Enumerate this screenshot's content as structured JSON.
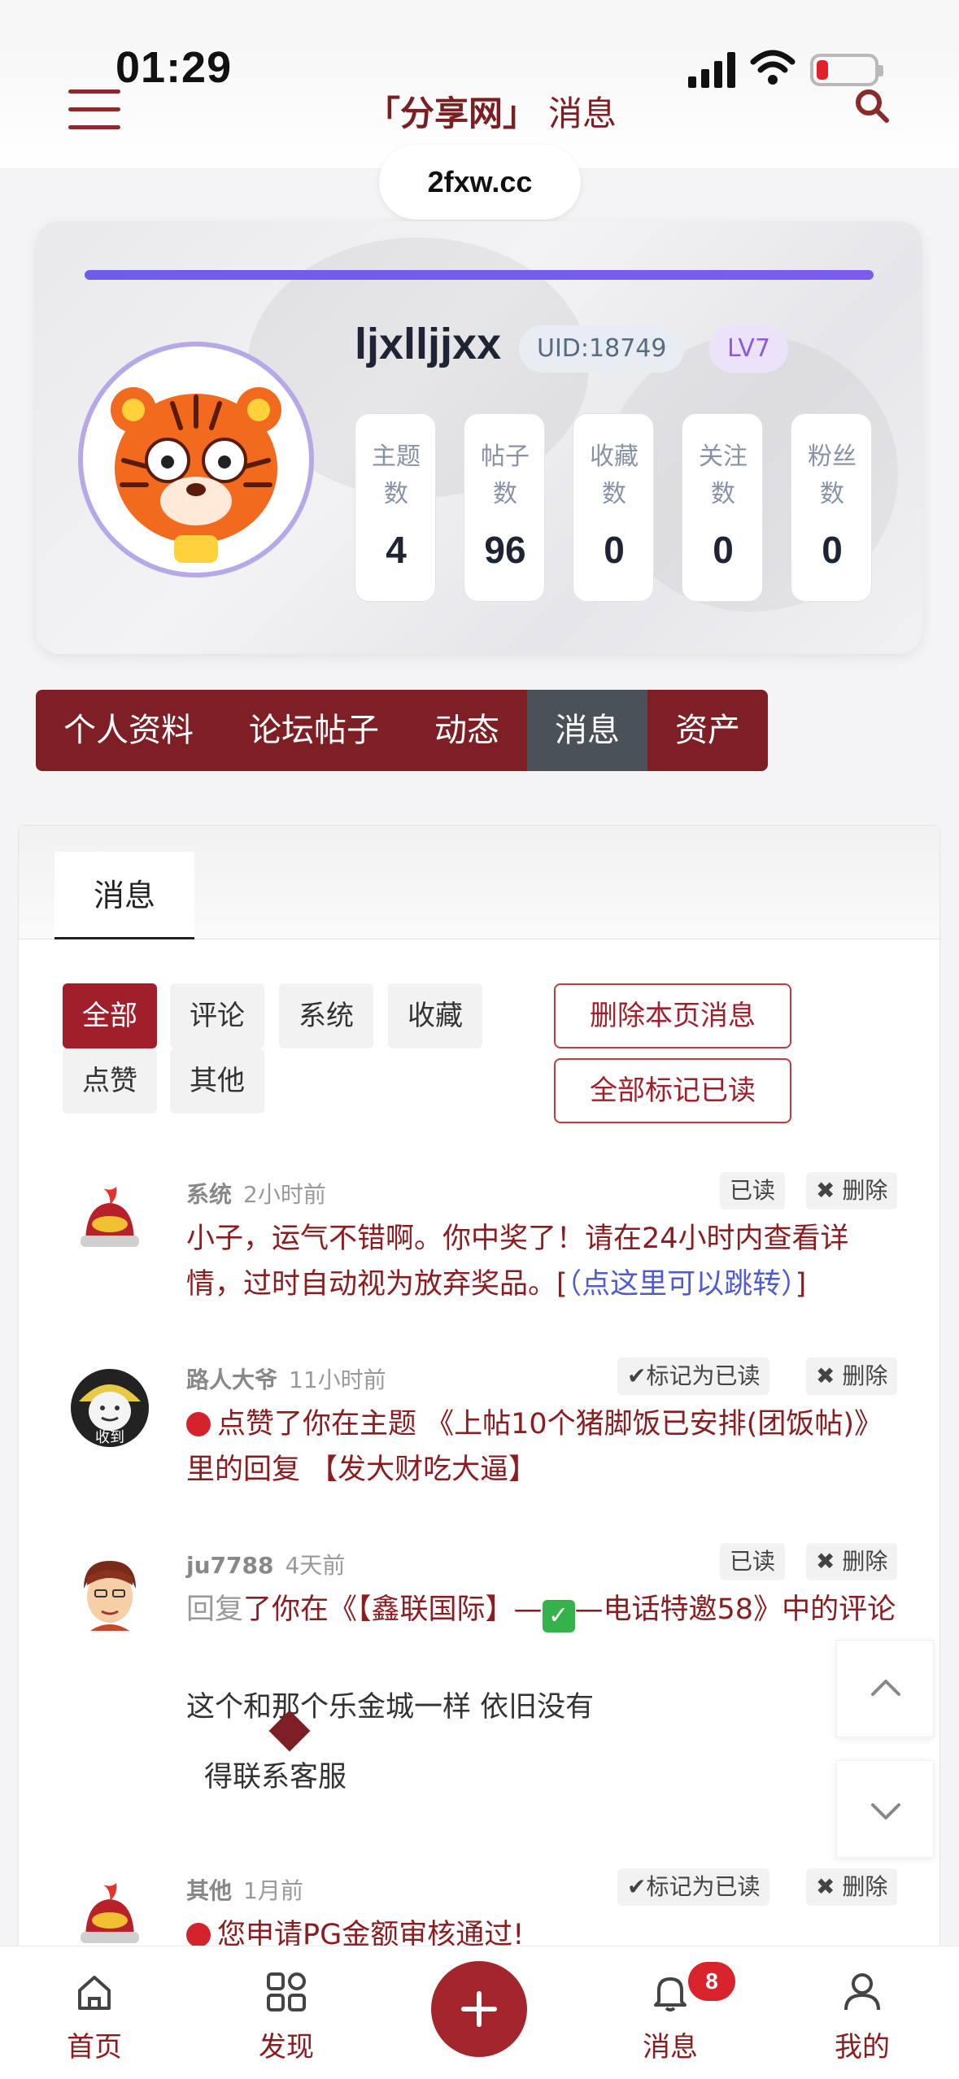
{
  "status_bar": {
    "time": "01:29"
  },
  "header": {
    "site_title": "「分享网」",
    "page_title": "消息",
    "domain": "2fxw.cc"
  },
  "profile": {
    "username": "ljxlljjxx",
    "uid": "UID:18749",
    "level": "LV7",
    "progress": 1.0,
    "stats": [
      {
        "label": "主题数",
        "value": "4"
      },
      {
        "label": "帖子数",
        "value": "96"
      },
      {
        "label": "收藏数",
        "value": "0"
      },
      {
        "label": "关注数",
        "value": "0"
      },
      {
        "label": "粉丝数",
        "value": "0"
      }
    ]
  },
  "tabs": [
    "个人资料",
    "论坛帖子",
    "动态",
    "消息",
    "资产"
  ],
  "active_tab": "消息",
  "panel": {
    "tab_label": "消息",
    "filters": [
      "全部",
      "评论",
      "系统",
      "收藏",
      "点赞",
      "其他"
    ],
    "active_filter": "全部",
    "delete_page": "删除本页消息",
    "mark_all_read": "全部标记已读"
  },
  "messages": [
    {
      "who": "系统",
      "when": "2小时前",
      "read_label": "已读",
      "delete_label": "✖ 删除",
      "text": "小子，运气不错啊。你中奖了！请在24小时内查看详情，过时自动视为放弃奖品。[",
      "link": "（点这里可以跳转）",
      "tail": "]"
    },
    {
      "who": "路人大爷",
      "when": "11小时前",
      "read_label": "✔标记为已读",
      "delete_label": "✖ 删除",
      "text": "点赞了你在主题 《上帖10个猪脚饭已安排(团饭帖)》里的回复 【发大财吃大逼】",
      "avatar_caption": "收到"
    },
    {
      "who": "ju7788",
      "when": "4天前",
      "read_label": "已读",
      "delete_label": "✖ 删除",
      "reply_word": "回复",
      "text_a": "了你在《【鑫联国际】—",
      "text_b": "—电话特邀58》中的评论",
      "quote": "这个和那个乐金城一样 依旧没有",
      "tooltip": "得联系客服"
    },
    {
      "who": "其他",
      "when": "1月前",
      "read_label": "✔标记为已读",
      "delete_label": "✖ 删除",
      "text": "您申请PG金额审核通过!"
    }
  ],
  "bottom_nav": {
    "items": [
      "首页",
      "发现",
      "消息",
      "我的"
    ],
    "badge": "8"
  },
  "colors": {
    "brand": "#7d1f24",
    "accent_red": "#a11f2b",
    "progress": "#6e5ce8",
    "link": "#4f5bd5"
  }
}
